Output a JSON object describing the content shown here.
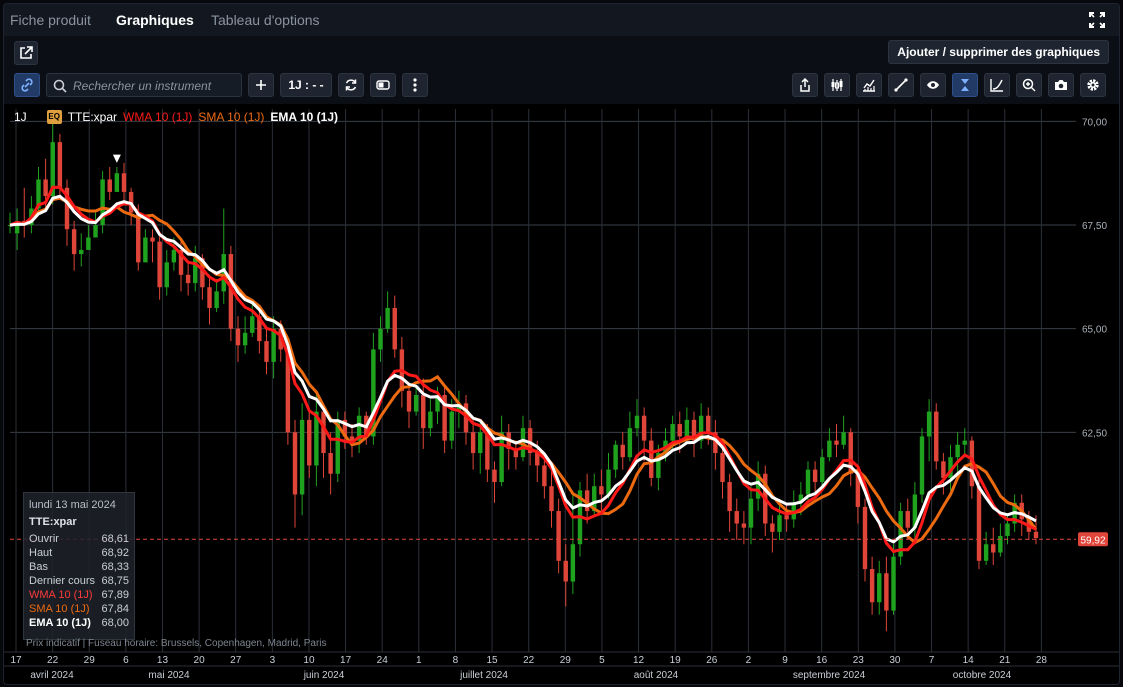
{
  "nav": {
    "tabs": [
      "Fiche produit",
      "Graphiques",
      "Tableau d'options"
    ],
    "active": 1
  },
  "toolbar": {
    "add_label": "Ajouter / supprimer des graphiques",
    "search_placeholder": "Rechercher un instrument",
    "interval_label": "1J : - -"
  },
  "legend": {
    "interval": "1J",
    "eq_badge": "EQ",
    "symbol": "TTE:xpar",
    "wma": "WMA 10 (1J)",
    "sma": "SMA 10 (1J)",
    "ema": "EMA 10 (1J)"
  },
  "tooltip": {
    "date": "lundi 13 mai 2024",
    "symbol": "TTE:xpar",
    "rows": [
      {
        "label": "Ouvrir",
        "value": "68,61"
      },
      {
        "label": "Haut",
        "value": "68,92"
      },
      {
        "label": "Bas",
        "value": "68,33"
      },
      {
        "label": "Dernier cours",
        "value": "68,75"
      },
      {
        "label": "WMA 10 (1J)",
        "value": "67,89"
      },
      {
        "label": "SMA 10 (1J)",
        "value": "67,84"
      },
      {
        "label": "EMA 10 (1J)",
        "value": "68,00"
      }
    ]
  },
  "footnote": "Prix indicatif  |  Fuseau horaire: Brussels, Copenhagen, Madrid, Paris",
  "colors": {
    "up": "#1fa31f",
    "down": "#e0453a",
    "wma": "#ff1a1a",
    "sma": "#ec6a10",
    "ema": "#ffffff",
    "grid": "#3a3f47",
    "last_price_bg": "#e0453a"
  },
  "chart_data": {
    "type": "candlestick",
    "symbol": "TTE:xpar",
    "ylim": [
      57.2,
      70.3
    ],
    "yticks": [
      70.0,
      67.5,
      65.0,
      62.5,
      60.0
    ],
    "ytick_labels": [
      "70,00",
      "67,50",
      "65,00",
      "62,50",
      "59,92"
    ],
    "last_price": "59,92",
    "day_ticks": [
      "17",
      "22",
      "29",
      "6",
      "13",
      "20",
      "27",
      "3",
      "10",
      "17",
      "24",
      "1",
      "8",
      "15",
      "22",
      "29",
      "5",
      "12",
      "19",
      "26",
      "2",
      "9",
      "16",
      "23",
      "30",
      "7",
      "14",
      "21",
      "28"
    ],
    "months": [
      "avril 2024",
      "mai 2024",
      "juin 2024",
      "juillet 2024",
      "août 2024",
      "septembre 2024",
      "octobre 2024"
    ],
    "candles": [
      [
        67.5,
        67.5,
        67.8,
        67.3
      ],
      [
        67.3,
        67.6,
        67.9,
        66.9
      ],
      [
        67.6,
        67.5,
        68.4,
        67.2
      ],
      [
        67.5,
        67.9,
        68.2,
        67.3
      ],
      [
        67.9,
        68.6,
        68.9,
        67.8
      ],
      [
        68.6,
        68.2,
        69.1,
        67.9
      ],
      [
        68.2,
        69.5,
        70.0,
        68.0
      ],
      [
        69.5,
        68.4,
        69.7,
        68.1
      ],
      [
        68.4,
        67.4,
        68.6,
        67.0
      ],
      [
        67.4,
        66.8,
        67.6,
        66.4
      ],
      [
        66.8,
        66.9,
        67.3,
        66.5
      ],
      [
        66.9,
        67.2,
        67.5,
        66.9
      ],
      [
        67.2,
        67.5,
        67.8,
        67.3
      ],
      [
        67.5,
        68.6,
        68.8,
        67.3
      ],
      [
        68.6,
        68.3,
        68.9,
        68.1
      ],
      [
        68.3,
        68.75,
        68.9,
        68.3
      ],
      [
        68.75,
        68.3,
        69.0,
        68.0
      ],
      [
        68.3,
        67.8,
        68.4,
        67.5
      ],
      [
        67.8,
        66.6,
        68.0,
        66.4
      ],
      [
        66.6,
        67.2,
        67.4,
        66.8
      ],
      [
        67.2,
        67.1,
        67.4,
        66.6
      ],
      [
        67.1,
        66.0,
        67.3,
        65.7
      ],
      [
        66.0,
        66.6,
        66.9,
        65.8
      ],
      [
        66.6,
        66.9,
        67.2,
        66.4
      ],
      [
        66.9,
        66.3,
        67.1,
        65.9
      ],
      [
        66.3,
        66.1,
        66.6,
        65.8
      ],
      [
        66.1,
        66.7,
        67.0,
        65.9
      ],
      [
        66.7,
        66.0,
        66.8,
        65.7
      ],
      [
        66.0,
        65.5,
        66.3,
        65.1
      ],
      [
        65.5,
        65.9,
        66.2,
        65.4
      ],
      [
        65.9,
        66.8,
        67.9,
        65.6
      ],
      [
        66.8,
        65.0,
        67.0,
        64.7
      ],
      [
        65.0,
        64.6,
        65.3,
        64.2
      ],
      [
        64.6,
        64.9,
        65.3,
        64.4
      ],
      [
        64.9,
        65.3,
        65.6,
        64.8
      ],
      [
        65.3,
        64.7,
        65.5,
        64.4
      ],
      [
        64.7,
        64.2,
        65.0,
        63.9
      ],
      [
        64.2,
        65.0,
        65.3,
        63.8
      ],
      [
        65.0,
        64.5,
        65.2,
        64.2
      ],
      [
        64.5,
        62.5,
        64.7,
        62.2
      ],
      [
        62.5,
        61.0,
        62.8,
        60.2
      ],
      [
        61.0,
        62.8,
        63.2,
        60.5
      ],
      [
        62.8,
        61.7,
        63.0,
        61.4
      ],
      [
        61.7,
        63.0,
        63.4,
        61.2
      ],
      [
        63.0,
        62.0,
        63.1,
        61.4
      ],
      [
        62.0,
        61.5,
        62.5,
        61.0
      ],
      [
        61.5,
        62.8,
        63.0,
        61.3
      ],
      [
        62.8,
        62.4,
        63.0,
        62.1
      ],
      [
        62.4,
        62.3,
        62.7,
        61.9
      ],
      [
        62.3,
        62.9,
        63.1,
        62.0
      ],
      [
        62.9,
        62.4,
        63.0,
        62.2
      ],
      [
        62.4,
        64.5,
        64.9,
        62.2
      ],
      [
        64.5,
        65.0,
        65.3,
        64.2
      ],
      [
        65.0,
        65.5,
        65.9,
        64.9
      ],
      [
        65.5,
        64.5,
        65.8,
        64.3
      ],
      [
        64.5,
        63.5,
        64.8,
        63.1
      ],
      [
        63.5,
        63.0,
        63.7,
        62.6
      ],
      [
        63.0,
        63.4,
        63.6,
        62.9
      ],
      [
        63.4,
        62.6,
        63.8,
        62.1
      ],
      [
        62.6,
        63.0,
        63.3,
        62.4
      ],
      [
        63.0,
        63.4,
        63.6,
        62.7
      ],
      [
        63.4,
        62.3,
        63.6,
        62.0
      ],
      [
        62.3,
        63.0,
        63.3,
        62.1
      ],
      [
        63.0,
        63.2,
        63.5,
        62.6
      ],
      [
        63.2,
        62.5,
        63.4,
        62.2
      ],
      [
        62.5,
        62.0,
        62.8,
        61.6
      ],
      [
        62.0,
        62.5,
        62.8,
        61.5
      ],
      [
        62.5,
        61.6,
        62.7,
        61.3
      ],
      [
        61.6,
        61.3,
        61.8,
        60.8
      ],
      [
        61.3,
        62.5,
        62.9,
        61.2
      ],
      [
        62.5,
        62.1,
        62.7,
        61.6
      ],
      [
        62.1,
        61.9,
        62.3,
        61.6
      ],
      [
        61.9,
        62.6,
        62.9,
        61.8
      ],
      [
        62.6,
        62.0,
        62.8,
        61.7
      ],
      [
        62.0,
        61.7,
        62.3,
        61.3
      ],
      [
        61.7,
        61.2,
        62.0,
        60.9
      ],
      [
        61.2,
        60.6,
        61.6,
        60.2
      ],
      [
        60.6,
        59.4,
        60.9,
        59.1
      ],
      [
        59.4,
        58.9,
        59.8,
        58.3
      ],
      [
        58.9,
        59.8,
        61.0,
        58.6
      ],
      [
        59.8,
        61.1,
        61.3,
        59.5
      ],
      [
        61.1,
        60.6,
        61.5,
        60.3
      ],
      [
        60.6,
        61.2,
        61.5,
        60.5
      ],
      [
        61.2,
        61.0,
        61.6,
        60.6
      ],
      [
        61.0,
        61.6,
        62.0,
        60.9
      ],
      [
        61.6,
        62.2,
        62.3,
        61.4
      ],
      [
        62.2,
        61.9,
        62.5,
        61.6
      ],
      [
        61.9,
        62.6,
        63.0,
        61.8
      ],
      [
        62.6,
        62.9,
        63.3,
        62.4
      ],
      [
        62.9,
        62.3,
        63.1,
        61.8
      ],
      [
        62.3,
        61.4,
        62.6,
        61.2
      ],
      [
        61.4,
        62.0,
        62.2,
        61.1
      ],
      [
        62.0,
        62.3,
        62.6,
        61.8
      ],
      [
        62.3,
        62.7,
        62.9,
        62.1
      ],
      [
        62.7,
        62.4,
        63.0,
        62.0
      ],
      [
        62.4,
        62.8,
        63.1,
        62.3
      ],
      [
        62.8,
        62.3,
        63.0,
        61.9
      ],
      [
        62.3,
        62.9,
        63.2,
        62.1
      ],
      [
        62.9,
        62.5,
        63.1,
        62.2
      ],
      [
        62.5,
        62.0,
        62.8,
        61.6
      ],
      [
        62.0,
        61.3,
        62.3,
        60.9
      ],
      [
        61.3,
        60.6,
        61.5,
        60.1
      ],
      [
        60.6,
        60.3,
        60.9,
        59.9
      ],
      [
        60.3,
        60.2,
        60.6,
        59.8
      ],
      [
        60.2,
        60.9,
        61.2,
        59.8
      ],
      [
        60.9,
        61.5,
        61.8,
        60.6
      ],
      [
        61.5,
        60.3,
        61.7,
        60.0
      ],
      [
        60.3,
        60.1,
        60.5,
        59.6
      ],
      [
        60.1,
        60.5,
        60.8,
        59.9
      ],
      [
        60.5,
        60.4,
        60.8,
        60.1
      ],
      [
        60.4,
        60.8,
        61.1,
        60.2
      ],
      [
        60.8,
        61.0,
        61.3,
        60.5
      ],
      [
        61.0,
        61.6,
        61.8,
        60.8
      ],
      [
        61.6,
        61.3,
        61.8,
        61.0
      ],
      [
        61.3,
        61.9,
        62.1,
        61.1
      ],
      [
        61.9,
        62.3,
        62.6,
        61.8
      ],
      [
        62.3,
        62.2,
        62.7,
        61.9
      ],
      [
        62.2,
        62.5,
        62.9,
        62.1
      ],
      [
        62.5,
        61.5,
        62.6,
        61.2
      ],
      [
        61.5,
        60.7,
        61.7,
        60.3
      ],
      [
        60.7,
        59.2,
        60.9,
        58.9
      ],
      [
        59.2,
        58.4,
        59.5,
        58.1
      ],
      [
        58.4,
        59.1,
        59.4,
        58.1
      ],
      [
        59.1,
        58.2,
        59.5,
        57.7
      ],
      [
        58.2,
        59.5,
        59.8,
        58.1
      ],
      [
        59.5,
        60.6,
        60.8,
        59.3
      ],
      [
        60.6,
        60.2,
        60.9,
        59.9
      ],
      [
        60.2,
        61.0,
        61.3,
        59.8
      ],
      [
        61.0,
        62.4,
        62.6,
        60.8
      ],
      [
        62.4,
        63.0,
        63.3,
        61.8
      ],
      [
        63.0,
        61.8,
        63.2,
        61.6
      ],
      [
        61.8,
        61.4,
        62.0,
        61.0
      ],
      [
        61.4,
        61.9,
        62.2,
        61.1
      ],
      [
        61.9,
        62.2,
        62.5,
        61.5
      ],
      [
        62.2,
        62.3,
        62.6,
        61.9
      ],
      [
        62.3,
        61.2,
        62.4,
        60.9
      ],
      [
        61.2,
        59.4,
        61.4,
        59.2
      ],
      [
        59.4,
        59.8,
        60.1,
        59.3
      ],
      [
        59.8,
        59.6,
        60.2,
        59.3
      ],
      [
        59.6,
        60.0,
        60.3,
        59.5
      ],
      [
        60.0,
        60.3,
        60.5,
        59.8
      ],
      [
        60.3,
        60.8,
        61.0,
        60.1
      ],
      [
        60.8,
        60.4,
        61.0,
        60.0
      ],
      [
        60.4,
        60.1,
        60.6,
        59.9
      ],
      [
        60.1,
        59.95,
        60.5,
        59.8
      ]
    ],
    "indicators": [
      "WMA 10 (1J)",
      "SMA 10 (1J)",
      "EMA 10 (1J)"
    ]
  }
}
